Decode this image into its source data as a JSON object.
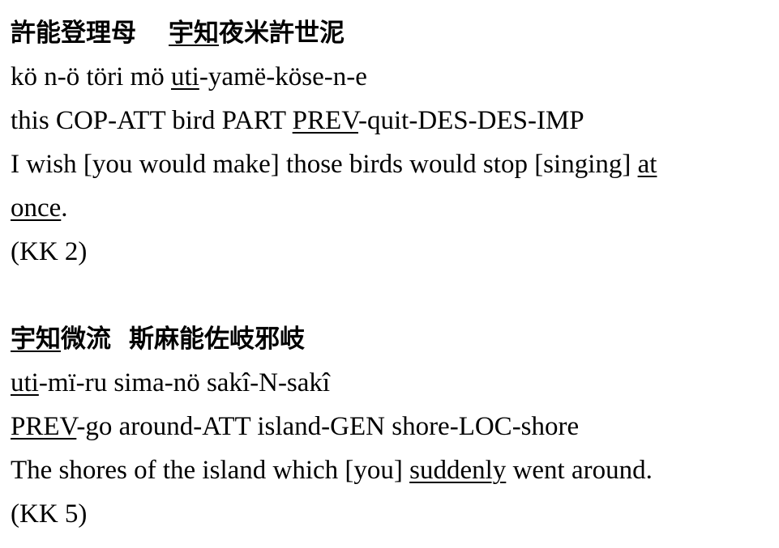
{
  "example1": {
    "kanji_a": "許能登理母",
    "kanji_b_underlined": "宇知",
    "kanji_c": "夜米許世泥",
    "translit_a": "kö n-ö töri mö ",
    "translit_b_underlined": "uti",
    "translit_c": "-yamë-köse-n-e",
    "gloss_a": "this COP-ATT bird PART ",
    "gloss_b_underlined": "PREV",
    "gloss_c": "-quit-DES-DES-IMP",
    "translation_a": "I wish [you would make] those birds would stop [singing] ",
    "translation_b_underlined": "at ",
    "translation_c_underlined": "once",
    "translation_d": ".",
    "source": "(KK 2)"
  },
  "example2": {
    "kanji_a_underlined": "宇知",
    "kanji_b": "微流",
    "kanji_c": "斯麻能佐岐邪岐",
    "translit_a_underlined": "uti",
    "translit_b": "-mï-ru sima-nö sakî-N-sakî",
    "gloss_a_underlined": "PREV",
    "gloss_b": "-go around-ATT island-GEN shore-LOC-shore",
    "translation_a": "The shores of the island which [you] ",
    "translation_b_underlined": "suddenly",
    "translation_c": " went around.",
    "source": "(KK 5)"
  }
}
